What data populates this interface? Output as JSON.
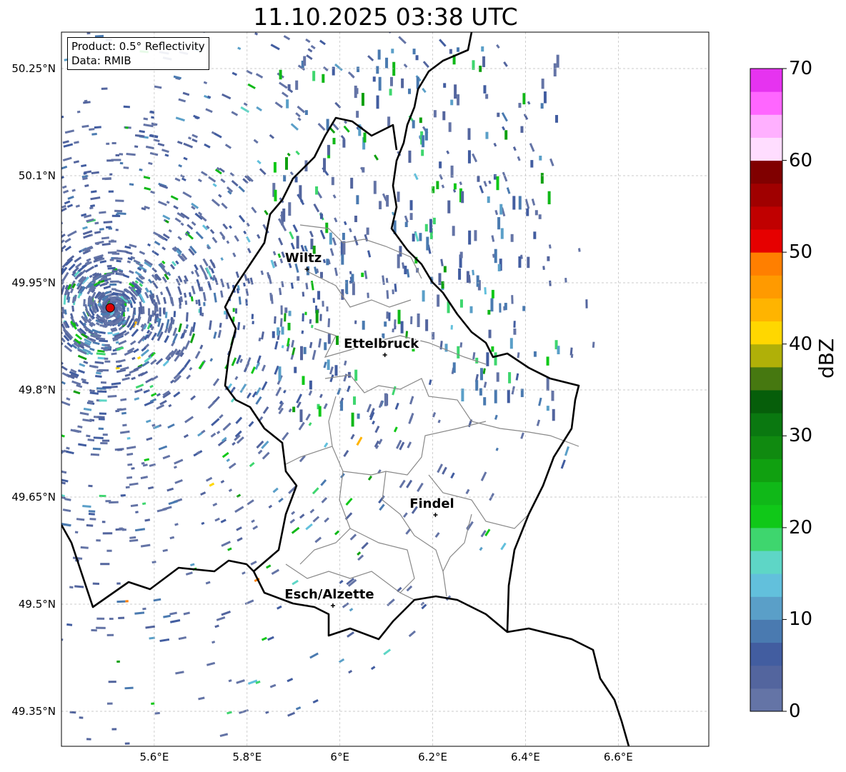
{
  "title": "11.10.2025 03:38 UTC",
  "info": {
    "product": "Product: 0.5° Reflectivity",
    "data": "Data: RMIB"
  },
  "map_extent": {
    "lon": [
      5.4,
      6.795
    ],
    "lat": [
      49.301,
      50.301
    ]
  },
  "lat_ticks": [
    {
      "v": 50.25,
      "label": "50.25°N"
    },
    {
      "v": 50.1,
      "label": "50.1°N"
    },
    {
      "v": 49.95,
      "label": "49.95°N"
    },
    {
      "v": 49.8,
      "label": "49.8°N"
    },
    {
      "v": 49.65,
      "label": "49.65°N"
    },
    {
      "v": 49.5,
      "label": "49.5°N"
    },
    {
      "v": 49.35,
      "label": "49.35°N"
    }
  ],
  "lon_ticks": [
    {
      "v": 5.6,
      "label": "5.6°E"
    },
    {
      "v": 5.8,
      "label": "5.8°E"
    },
    {
      "v": 6.0,
      "label": "6°E"
    },
    {
      "v": 6.2,
      "label": "6.2°E"
    },
    {
      "v": 6.4,
      "label": "6.4°E"
    },
    {
      "v": 6.6,
      "label": "6.6°E"
    }
  ],
  "cities": [
    {
      "name": "Wiltz",
      "lon": 5.929,
      "lat": 49.969
    },
    {
      "name": "Ettelbruck",
      "lon": 6.097,
      "lat": 49.849
    },
    {
      "name": "Findel",
      "lon": 6.206,
      "lat": 49.625
    },
    {
      "name": "Esch/Alzette",
      "lon": 5.985,
      "lat": 49.498
    }
  ],
  "radar_site": {
    "lon": 5.505,
    "lat": 49.915,
    "color": "#e00000"
  },
  "colorbar": {
    "label": "dBZ",
    "min": 0,
    "max": 70,
    "step": 2.5,
    "ticks": [
      "0",
      "10",
      "20",
      "30",
      "40",
      "50",
      "60",
      "70"
    ],
    "colors": [
      "#6474a6",
      "#53659e",
      "#425da0",
      "#4a7ab0",
      "#5a9fc8",
      "#62c0dc",
      "#5ed6c6",
      "#3ed66e",
      "#10c818",
      "#10b818",
      "#10a010",
      "#108a10",
      "#0a7810",
      "#065e0a",
      "#467810",
      "#b0b008",
      "#ffd700",
      "#ffb400",
      "#ff9a00",
      "#ff7f00",
      "#e60000",
      "#c00000",
      "#a00000",
      "#800000",
      "#ffddff",
      "#ffb0ff",
      "#ff66ff",
      "#e633f0"
    ]
  }
}
